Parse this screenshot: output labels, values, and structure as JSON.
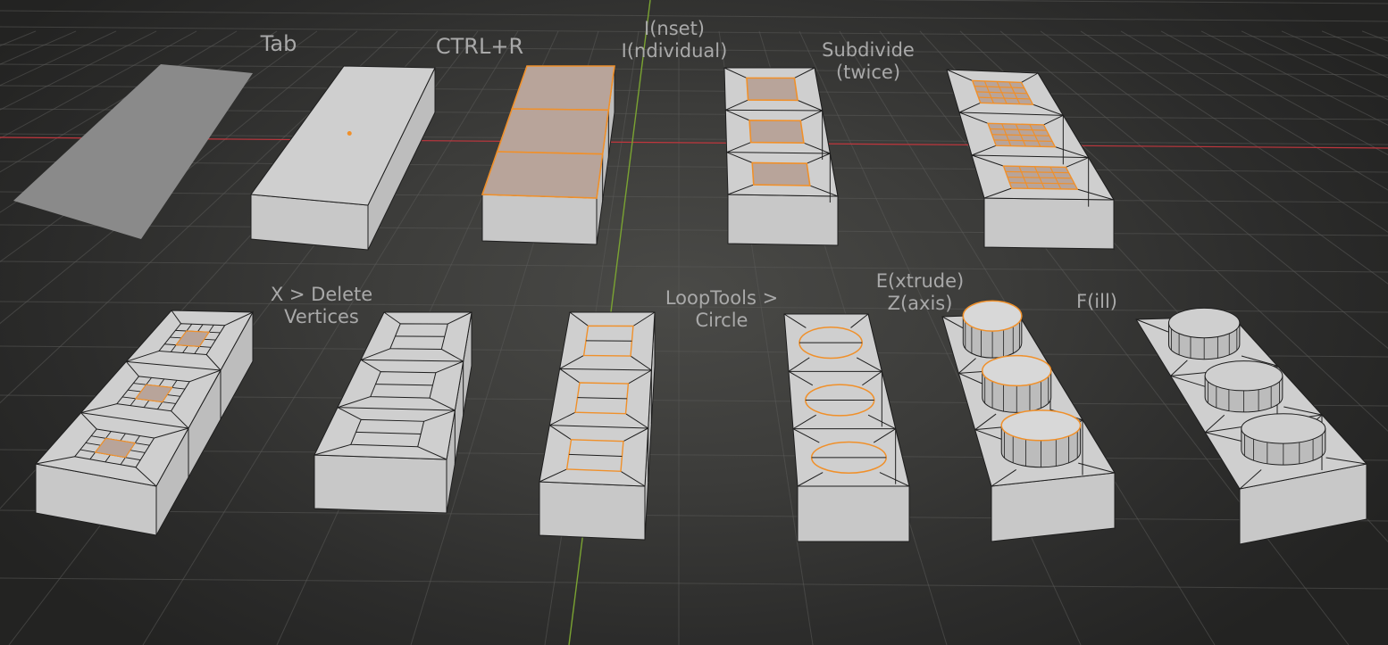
{
  "viewport": {
    "theme": {
      "grid_color": "#5a5a58",
      "x_axis_color": "#c0363d",
      "y_axis_color": "#7aa332",
      "mesh_face": "#cfcfcf",
      "mesh_edge": "#1e1e1e",
      "selection": "#f0902a",
      "selected_face": "#b8a49a",
      "object_mode_mesh": "#8a8a8a",
      "label_color": "#a9a9a9"
    },
    "labels": {
      "tab": "Tab",
      "ctrl_r": "CTRL+R",
      "inset": "I(nset)\nI(ndividual)",
      "subdivide": "Subdivide\n(twice)",
      "delete_vertices": "X > Delete\nVertices",
      "looptools_circle": "LoopTools >\nCircle",
      "extrude_z": "E(xtrude)\nZ(axis)",
      "fill": "F(ill)"
    }
  }
}
